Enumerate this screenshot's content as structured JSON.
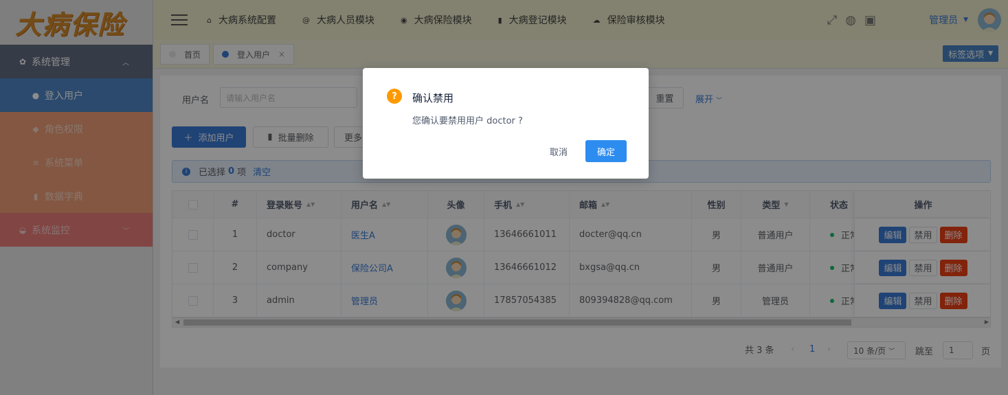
{
  "logo": "大病保险",
  "sidebar": {
    "items": [
      {
        "label": "系统管理"
      },
      {
        "label": "登入用户"
      },
      {
        "label": "角色权限"
      },
      {
        "label": "系统菜单"
      },
      {
        "label": "数据字典"
      },
      {
        "label": "系统监控"
      }
    ]
  },
  "header": {
    "nav": [
      {
        "label": "大病系统配置",
        "icon": "home-icon"
      },
      {
        "label": "大病人员模块",
        "icon": "at-icon"
      },
      {
        "label": "大病保险模块",
        "icon": "target-icon"
      },
      {
        "label": "大病登记模块",
        "icon": "book-icon"
      },
      {
        "label": "保险审核模块",
        "icon": "cloud-icon"
      }
    ],
    "user": "管理员"
  },
  "tags": {
    "home": "首页",
    "current": "登入用户",
    "options": "标签选项"
  },
  "search": {
    "username_label": "用户名",
    "username_placeholder": "请输入用户名",
    "reset": "重置",
    "expand": "展开"
  },
  "toolbar": {
    "add": "添加用户",
    "batch_delete": "批量删除",
    "more": "更多"
  },
  "selection": {
    "prefix": "已选择",
    "count": "0",
    "suffix": "项",
    "clear": "清空"
  },
  "table": {
    "headers": {
      "index": "#",
      "account": "登录账号",
      "username": "用户名",
      "avatar": "头像",
      "phone": "手机",
      "email": "邮箱",
      "gender": "性别",
      "type": "类型",
      "status": "状态",
      "actions": "操作"
    },
    "rows": [
      {
        "index": "1",
        "account": "doctor",
        "username": "医生A",
        "phone": "13646661011",
        "email": "docter@qq.cn",
        "gender": "男",
        "type": "普通用户",
        "status": "正常"
      },
      {
        "index": "2",
        "account": "company",
        "username": "保险公司A",
        "phone": "13646661012",
        "email": "bxgsa@qq.cn",
        "gender": "男",
        "type": "普通用户",
        "status": "正常"
      },
      {
        "index": "3",
        "account": "admin",
        "username": "管理员",
        "phone": "17857054385",
        "email": "809394828@qq.com",
        "gender": "男",
        "type": "管理员",
        "status": "正常"
      }
    ],
    "actions": {
      "edit": "编辑",
      "disable": "禁用",
      "delete": "删除"
    }
  },
  "pagination": {
    "total": "共 3 条",
    "current": "1",
    "page_size": "10 条/页",
    "goto_label": "跳至",
    "goto_value": "1",
    "page_suffix": "页"
  },
  "modal": {
    "title": "确认禁用",
    "message": "您确认要禁用用户 doctor ?",
    "cancel": "取消",
    "ok": "确定"
  },
  "colors": {
    "primary": "#3a7bd5",
    "danger": "#ed4014",
    "warning": "#ff9900",
    "success": "#19be6b"
  }
}
